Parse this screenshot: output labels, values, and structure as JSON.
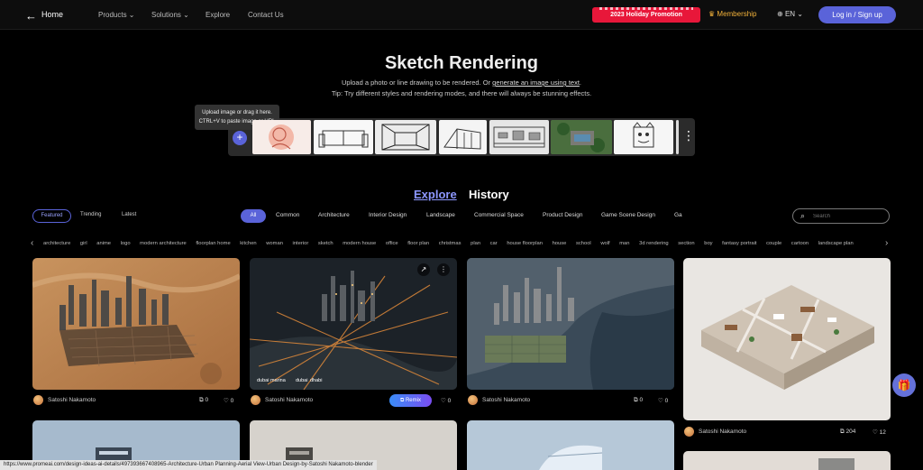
{
  "nav": {
    "back_icon": "←",
    "home": "Home",
    "products": "Products ⌄",
    "solutions": "Solutions ⌄",
    "explore": "Explore",
    "contact": "Contact Us",
    "promo": "2023 Holiday Promotion",
    "membership": "Membership",
    "lang": "EN ⌄",
    "login": "Log in / Sign up"
  },
  "hero": {
    "title": "Sketch Rendering",
    "subtitle_prefix": "Upload a photo or line drawing to be rendered. Or ",
    "subtitle_link": "generate an image using text",
    "subtitle_suffix": ".",
    "tip": "Tip: Try different styles and rendering modes, and there will always be stunning effects.",
    "tooltip_line1": "Upload image or drag it here.",
    "tooltip_line2": "CTRL+V to paste image or URL",
    "plus": "+",
    "more": "⋮"
  },
  "tabs": {
    "explore": "Explore",
    "history": "History"
  },
  "sort": {
    "featured": "Featured",
    "trending": "Trending",
    "latest": "Latest"
  },
  "categories": [
    "All",
    "Common",
    "Architecture",
    "Interior Design",
    "Landscape",
    "Commercial Space",
    "Product Design",
    "Game Scene Design",
    "Ga"
  ],
  "search": {
    "placeholder": "Search",
    "icon": "search-icon"
  },
  "tags": [
    "architecture",
    "girl",
    "anime",
    "logo",
    "modern architecture",
    "floorplan home",
    "kitchen",
    "woman",
    "interior",
    "sketch",
    "modern house",
    "office",
    "floor plan",
    "christmas",
    "plan",
    "car",
    "house floorplan",
    "house",
    "school",
    "wolf",
    "man",
    "3d rendering",
    "section",
    "boy",
    "fantasy portrait",
    "couple",
    "cartoon",
    "landscape plan"
  ],
  "cards": {
    "c1": {
      "author": "Satoshi Nakamoto",
      "remixes": "0",
      "likes": "0"
    },
    "c2": {
      "author": "Satoshi Nakamoto",
      "remix_label": "Remix",
      "likes": "0",
      "labels": [
        "dubai marina",
        "dubai",
        "dhabi"
      ]
    },
    "c3": {
      "author": "Satoshi Nakamoto",
      "remixes": "0",
      "likes": "0"
    },
    "c4": {
      "author": "Satoshi Nakamoto",
      "remixes": "204",
      "likes": "12"
    }
  },
  "status_url": "https://www.promeai.com/design-ideas-ai-details/497393667408965-Architecture-Urban Planning-Aerial View-Urban Design-by-Satoshi Nakamoto-blender",
  "colors": {
    "accent": "#5a63d9",
    "promo": "#e8173a",
    "gold": "#f3b23a"
  }
}
